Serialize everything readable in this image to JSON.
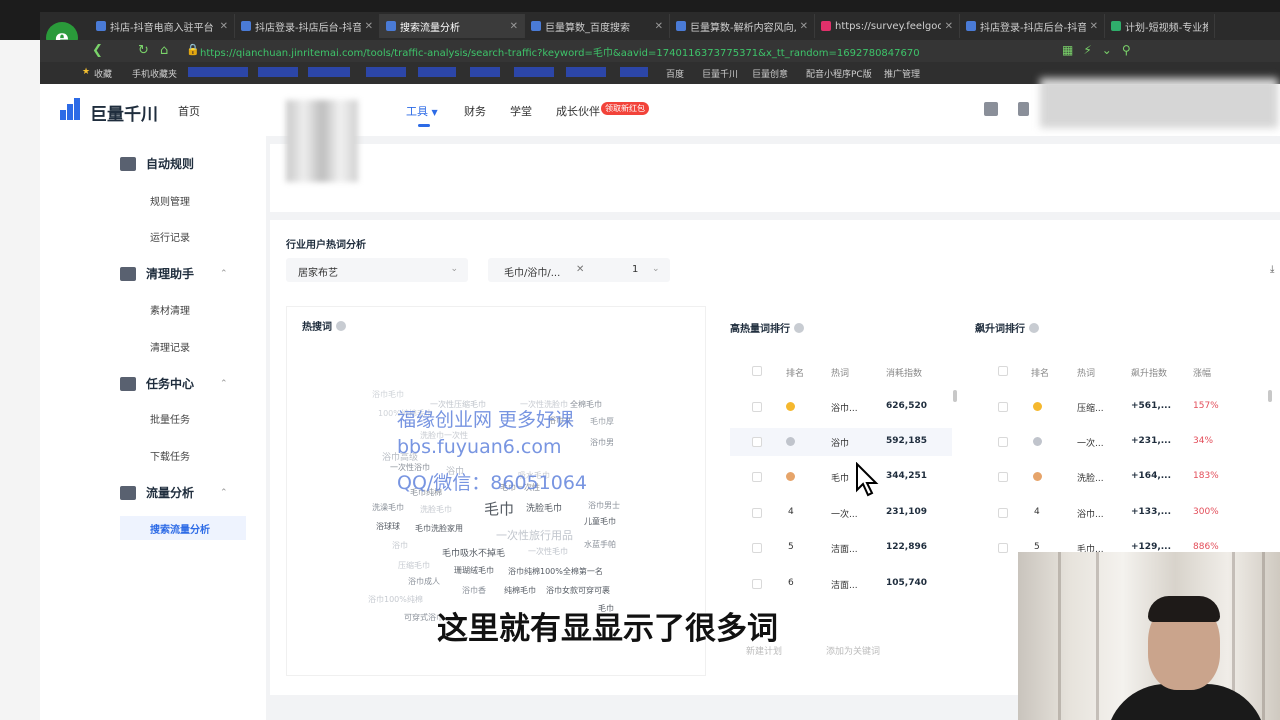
{
  "browser": {
    "logo_letter": "e",
    "tabs": [
      {
        "title": "抖店-抖音电商入驻平台",
        "active": false
      },
      {
        "title": "抖店登录-抖店后台-抖音电",
        "active": false
      },
      {
        "title": "搜索流量分析",
        "active": true
      },
      {
        "title": "巨量算数_百度搜索",
        "active": false
      },
      {
        "title": "巨量算数-解析内容风向,",
        "active": false
      },
      {
        "title": "https://survey.feelgood",
        "active": false
      },
      {
        "title": "抖店登录-抖店后台-抖音电",
        "active": false
      },
      {
        "title": "计划-短视频-专业推广",
        "active": false
      }
    ],
    "url": "https://qianchuan.jinritemai.com/tools/traffic-analysis/search-traffic?keyword=毛巾&aavid=1740116373775371&x_tt_random=1692780847670",
    "bookmarks": [
      "收藏",
      "手机收藏夹",
      "百度",
      "巨量千川",
      "巨量创意",
      "配音小程序PC版",
      "推广管理"
    ]
  },
  "app": {
    "logo_text": "巨量千川",
    "home": "首页",
    "nav": [
      {
        "label": "工具",
        "active": true
      },
      {
        "label": "财务",
        "active": false
      },
      {
        "label": "学堂",
        "active": false
      },
      {
        "label": "成长伙伴",
        "active": false
      }
    ],
    "nav_badge": "领取新红包",
    "sidebar": {
      "groups": [
        {
          "label": "自动规则",
          "items": [
            "规则管理",
            "运行记录"
          ]
        },
        {
          "label": "清理助手",
          "items": [
            "素材清理",
            "清理记录"
          ]
        },
        {
          "label": "任务中心",
          "items": [
            "批量任务",
            "下载任务"
          ]
        },
        {
          "label": "流量分析",
          "items": [
            "搜索流量分析"
          ]
        }
      ],
      "active_item": "搜索流量分析"
    },
    "section_title": "行业用户热词分析",
    "filters": {
      "industry": "居家布艺",
      "keyword_tag": "毛巾/浴巾/...",
      "keyword_count": "1"
    },
    "hot_words": {
      "title": "热搜词",
      "words": [
        "浴巾毛巾",
        "一次性压缩毛巾",
        "一次性洗脸巾",
        "全棉毛巾",
        "100%纯棉毛巾",
        "浴巾女",
        "毛巾厚",
        "洗脸巾一次性",
        "浴巾男",
        "浴巾高级",
        "一次性浴巾",
        "浴巾",
        "吸水毛巾",
        "毛巾纯棉",
        "洗澡毛巾",
        "毛巾",
        "洗脸毛巾",
        "浴巾男士",
        "洗脸毛巾",
        "毛巾一次性",
        "儿童毛巾",
        "浴球球",
        "毛巾洗脸家用",
        "一次性旅行用品",
        "浴巾",
        "毛巾吸水不掉毛",
        "一次性毛巾",
        "水蓝手帕",
        "压缩毛巾",
        "珊瑚绒毛巾",
        "浴巾纯棉100%全棉第一名",
        "浴巾成人",
        "浴巾香",
        "纯棉毛巾",
        "浴巾女款可穿可裹",
        "浴巾100%纯棉",
        "毛巾",
        "可穿式浴巾"
      ]
    },
    "high_rank": {
      "title": "高热量词排行",
      "headers": [
        "排名",
        "热词",
        "消耗指数"
      ],
      "rows": [
        {
          "rank": "",
          "word": "浴巾...",
          "value": "626,520"
        },
        {
          "rank": "",
          "word": "浴巾",
          "value": "592,185"
        },
        {
          "rank": "",
          "word": "毛巾",
          "value": "344,251"
        },
        {
          "rank": "4",
          "word": "一次...",
          "value": "231,109"
        },
        {
          "rank": "5",
          "word": "洁面...",
          "value": "122,896"
        },
        {
          "rank": "6",
          "word": "洁面...",
          "value": "105,740"
        }
      ],
      "buttons": [
        "新建计划",
        "添加为关键词"
      ]
    },
    "rise_rank": {
      "title": "飙升词排行",
      "headers": [
        "排名",
        "热词",
        "飙升指数",
        "涨幅"
      ],
      "rows": [
        {
          "rank": "",
          "word": "压缩...",
          "value": "+561,...",
          "pct": "157%"
        },
        {
          "rank": "",
          "word": "一次...",
          "value": "+231,...",
          "pct": "34%"
        },
        {
          "rank": "",
          "word": "洗脸...",
          "value": "+164,...",
          "pct": "183%"
        },
        {
          "rank": "4",
          "word": "浴巾...",
          "value": "+133,...",
          "pct": "300%"
        },
        {
          "rank": "5",
          "word": "毛巾...",
          "value": "+129,...",
          "pct": "886%"
        }
      ]
    }
  },
  "overlay": {
    "watermark_lines": [
      "福缘创业网 更多好课",
      "bbs.fuyuan6.com",
      "QQ/微信：86051064"
    ],
    "subtitle": "这里就有显显示了很多词"
  },
  "colors": {
    "accent": "#2d6be6",
    "red": "#e34d59",
    "gold": "#f5b82e",
    "silver": "#c0c4cc",
    "bronze": "#e6a46a"
  }
}
